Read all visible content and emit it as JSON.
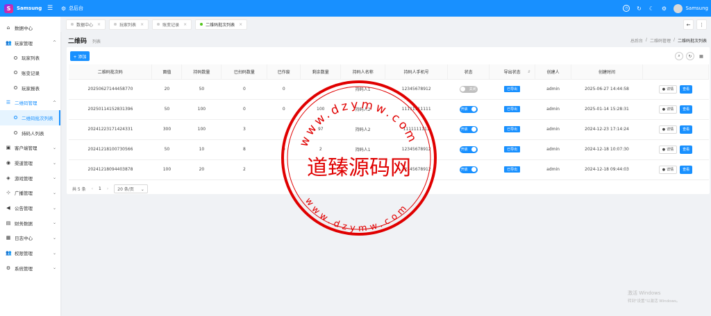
{
  "header": {
    "app_name": "Samsung",
    "logo_letter": "S",
    "home_label": "总后台",
    "user_name": "Samsung",
    "icons": [
      "menu-icon",
      "gear-icon",
      "clock-icon",
      "refresh-icon",
      "moon-icon",
      "settings-icon"
    ]
  },
  "sidebar": {
    "items": [
      {
        "label": "数据中心",
        "icon": "home-icon"
      },
      {
        "label": "玩家管理",
        "icon": "users-icon",
        "arrow": "^"
      },
      {
        "label": "玩家列表"
      },
      {
        "label": "账变记录"
      },
      {
        "label": "玩家报表"
      },
      {
        "label": "二维码管理",
        "icon": "list-icon",
        "arrow": "^"
      },
      {
        "label": "二维码批次列表"
      },
      {
        "label": "持码人列表"
      },
      {
        "label": "客户端管理",
        "icon": "monitor-icon",
        "arrow": "v"
      },
      {
        "label": "渠道管理",
        "icon": "channel-icon",
        "arrow": "v"
      },
      {
        "label": "游戏管理",
        "icon": "gamepad-icon",
        "arrow": "v"
      },
      {
        "label": "广播管理",
        "icon": "broadcast-icon",
        "arrow": "v"
      },
      {
        "label": "公告管理",
        "icon": "megaphone-icon",
        "arrow": "v"
      },
      {
        "label": "财务数据",
        "icon": "finance-icon",
        "arrow": "v"
      },
      {
        "label": "日志中心",
        "icon": "log-icon",
        "arrow": "v"
      },
      {
        "label": "权限管理",
        "icon": "permission-icon",
        "arrow": "v"
      },
      {
        "label": "系统管理",
        "icon": "gear-icon",
        "arrow": "v"
      }
    ]
  },
  "tabs": [
    {
      "label": "数据中心"
    },
    {
      "label": "玩家列表"
    },
    {
      "label": "账变记录"
    },
    {
      "label": "二维码批次列表"
    }
  ],
  "page": {
    "title": "二维码",
    "subtitle": "列表",
    "breadcrumb": [
      "总后台",
      "二维码管理",
      "二维码批次列表"
    ]
  },
  "toolbar": {
    "add_label": "+ 添加"
  },
  "table": {
    "columns": [
      "二维码批次码",
      "面值",
      "持码数量",
      "已扫码数量",
      "已作废",
      "剩余数量",
      "持码人名称",
      "持码人手机号",
      "状态",
      "导出状态",
      "创建人",
      "创建时间",
      ""
    ],
    "rows": [
      {
        "batch": "20250627144458770",
        "face": "20",
        "qty": "50",
        "scanned": "0",
        "void": "0",
        "remain": "",
        "holder": "持码人1",
        "phone": "12345678912",
        "status": "关闭",
        "status_on": false,
        "export": "已导出",
        "creator": "admin",
        "time": "2025-06-27 14:44:58"
      },
      {
        "batch": "20250114152831396",
        "face": "50",
        "qty": "100",
        "scanned": "0",
        "void": "0",
        "remain": "100",
        "holder": "持码人2",
        "phone": "11111111111",
        "status": "开启",
        "status_on": true,
        "export": "已导出",
        "creator": "admin",
        "time": "2025-01-14 15:28:31"
      },
      {
        "batch": "20241223171424331",
        "face": "300",
        "qty": "100",
        "scanned": "3",
        "void": "",
        "remain": "97",
        "holder": "持码人2",
        "phone": "1111111111",
        "status": "开启",
        "status_on": true,
        "export": "已导出",
        "creator": "admin",
        "time": "2024-12-23 17:14:24"
      },
      {
        "batch": "20241218100730566",
        "face": "50",
        "qty": "10",
        "scanned": "8",
        "void": "0",
        "remain": "2",
        "holder": "持码人1",
        "phone": "12345678912",
        "status": "开启",
        "status_on": true,
        "export": "已导出",
        "creator": "admin",
        "time": "2024-12-18 10:07:30"
      },
      {
        "batch": "20241218094403878",
        "face": "100",
        "qty": "20",
        "scanned": "2",
        "void": "1",
        "remain": "",
        "holder": "",
        "phone": "12345678912",
        "status": "开启",
        "status_on": true,
        "export": "已导出",
        "creator": "admin",
        "time": "2024-12-18 09:44:03"
      }
    ],
    "op_detail": "详情",
    "op_view": "查看"
  },
  "pagination": {
    "total": "共 5 条",
    "current": "1",
    "page_size": "20 条/页"
  },
  "watermark": {
    "stamp_text": "道臻源码网",
    "stamp_url_top": "www.dzymw.com",
    "stamp_url_bottom": "www.dzymw.com",
    "color": "#e00000"
  },
  "windows_activation": {
    "line1": "激活 Windows",
    "line2": "转到\"设置\"以激活 Windows。"
  }
}
